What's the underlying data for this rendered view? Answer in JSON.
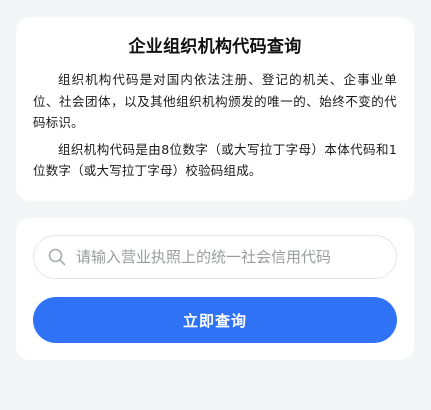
{
  "info": {
    "title": "企业组织机构代码查询",
    "paragraphs": [
      "组织机构代码是对国内依法注册、登记的机关、企事业单位、社会团体，以及其他组织机构颁发的唯一的、始终不变的代码标识。",
      "组织机构代码是由8位数字（或大写拉丁字母）本体代码和1位数字（或大写拉丁字母）校验码组成。"
    ]
  },
  "search": {
    "icon": "search-icon",
    "value": "",
    "placeholder": "请输入营业执照上的统一社会信用代码"
  },
  "query_button": {
    "label": "立即查询"
  },
  "colors": {
    "primary": "#2f72f5",
    "background": "#f4f5f7",
    "card": "#ffffff"
  }
}
